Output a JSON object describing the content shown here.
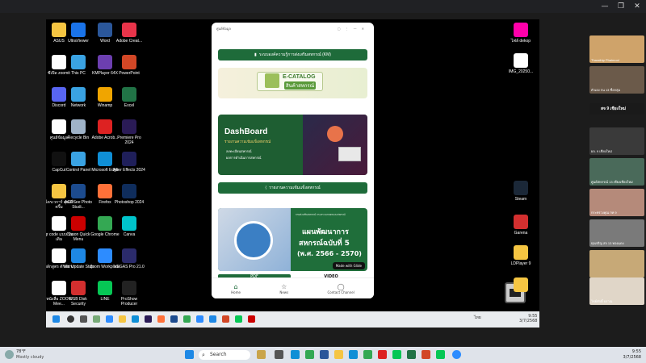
{
  "desktop_icons": [
    {
      "label": "ASUS",
      "color": "#f5c542"
    },
    {
      "label": "UltraViewer",
      "color": "#1a73e8"
    },
    {
      "label": "Word",
      "color": "#2b579a"
    },
    {
      "label": "Adobe Creat...",
      "color": "#e8344a"
    },
    {
      "label": "ซีเปิด zoomit",
      "color": "#ffffff"
    },
    {
      "label": "This PC",
      "color": "#3aa3e3"
    },
    {
      "label": "KMPlayer 64X",
      "color": "#6c3fb0"
    },
    {
      "label": "PowerPoint",
      "color": "#d24726"
    },
    {
      "label": "Discord",
      "color": "#5865f2"
    },
    {
      "label": "Network",
      "color": "#3aa3e3"
    },
    {
      "label": "Winamp",
      "color": "#f0a500"
    },
    {
      "label": "Excel",
      "color": "#217346"
    },
    {
      "label": "ศูนย์ข้อมูล",
      "color": "#ffffff"
    },
    {
      "label": "Recycle Bin",
      "color": "#9fb3c8"
    },
    {
      "label": "Adobe Acrob...",
      "color": "#d22"
    },
    {
      "label": "Premiere Pro 2024",
      "color": "#2a1b56"
    },
    {
      "label": "CapCut",
      "color": "#111111"
    },
    {
      "label": "Control Panel",
      "color": "#3aa3e3"
    },
    {
      "label": "Microsoft Edge",
      "color": "#0f8fd6"
    },
    {
      "label": "After Effects 2024",
      "color": "#1f1f5a"
    },
    {
      "label": "ไดรเวการ์ คุณส์ ครึ้ม",
      "color": "#f5c542"
    },
    {
      "label": "ACDSee Photo Studi...",
      "color": "#1c4b8e"
    },
    {
      "label": "Firefox",
      "color": "#ff7139"
    },
    {
      "label": "Photoshop 2024",
      "color": "#0f2d5c"
    },
    {
      "label": "qr code แบบ บันเดิม",
      "color": "#ffffff"
    },
    {
      "label": "Canon Quick Menu",
      "color": "#c00"
    },
    {
      "label": "Google Chrome",
      "color": "#34a853"
    },
    {
      "label": "Canva",
      "color": "#00c4cc"
    },
    {
      "label": "หลักสูตร ตัวอย่าง",
      "color": "#ffffff"
    },
    {
      "label": "Win Update Stop",
      "color": "#1e88e5"
    },
    {
      "label": "Zoom Workplace",
      "color": "#2d8cff"
    },
    {
      "label": "VEGAS Pro 21.0",
      "color": "#2b2b6b"
    },
    {
      "label": "หนังสือ ZOOM Mee...",
      "color": "#ffffff"
    },
    {
      "label": "USB Disk Security",
      "color": "#d32f2f"
    },
    {
      "label": "LINE",
      "color": "#06c755"
    },
    {
      "label": "ProShow Producer",
      "color": "#222222"
    },
    {
      "label": "หนังสือ ZOOM Mee...",
      "color": "#ffffff"
    }
  ],
  "right_desktop_icons": [
    {
      "label": "ไฟล์ dekop",
      "color": "#f0a"
    },
    {
      "label": "IMG_20250...",
      "color": "#ffffff"
    },
    {
      "label": "Steam",
      "color": "#1b2838"
    },
    {
      "label": "Garena",
      "color": "#d32f2f"
    },
    {
      "label": "LDPlayer 9",
      "color": "#f5c542"
    },
    {
      "label": "",
      "color": "#f5c542"
    }
  ],
  "phone": {
    "header_text": "ศูนย์ข้อมูล",
    "km_button": "ระบบองค์ความรู้การส่งเสริมสหกรณ์ (KM)",
    "ecatalog_title": "E-CATALOG",
    "ecatalog_sub": "สินค้าสหกรณ์",
    "dashboard_title": "DashBoard",
    "dashboard_sub": "รายงานความเข้มแข็งสหกรณ์",
    "dashboard_items": [
      "ลงทะเบียนสหกรณ์",
      "ผลการดำเนินการสหกรณ์"
    ],
    "strength_button": "รายงานความเข้มแข็งสหกรณ์",
    "plan_title_1": "แผนพัฒนาการ",
    "plan_title_2": "สหกรณ์ฉบับที่ 5",
    "plan_title_3": "(พ.ศ. 2566 - 2570)",
    "plan_org": "กรมส่งเสริมสหกรณ์ กระทรวงเกษตรและสหกรณ์",
    "glide_badge": "Made with Glide",
    "pdf_label": "PDF",
    "video_label": "VIDEO",
    "nav": [
      "Home",
      "News",
      "Contact Channel"
    ]
  },
  "inner_taskbar": {
    "time": "9:55",
    "date": "3/7/2568",
    "lang": "ไทย"
  },
  "participants": [
    {
      "name": "Tharathip Phaimool",
      "bg": "#cfa36a"
    },
    {
      "name": "ตัวเอง กน 13 ชื่อกลุ่ม",
      "bg": "#6b5a4a"
    },
    {
      "name": "สจ 9 เชียงใหม่",
      "bg": "#1a1a1a",
      "text_only": true
    },
    {
      "name": "ผจ. 9 เชียงใหม่",
      "bg": "#3a3a3a"
    },
    {
      "name": "ศูนย์สหกรณ์ 13 เชียงเชียงใหม่",
      "bg": "#4a6a5a"
    },
    {
      "name": "กระทรวงคุณ กท 9",
      "bg": "#b58a7a"
    },
    {
      "name": "ทุ่งเจริญ สจ 13 ทองแดง",
      "bg": "#7a7a7a"
    },
    {
      "name": "คทช.เลขาธรรม_สหกิญญา",
      "bg": "#5a6a4a"
    },
    {
      "name": "",
      "bg": "#c7a977"
    },
    {
      "name": "ไชย์ศักดิ์ บราณ",
      "bg": "#e0d6c8"
    }
  ],
  "host_taskbar": {
    "temp": "78°F",
    "weather": "Mostly cloudy",
    "search_placeholder": "Search",
    "time": "9:55",
    "date": "3/7/2568"
  }
}
